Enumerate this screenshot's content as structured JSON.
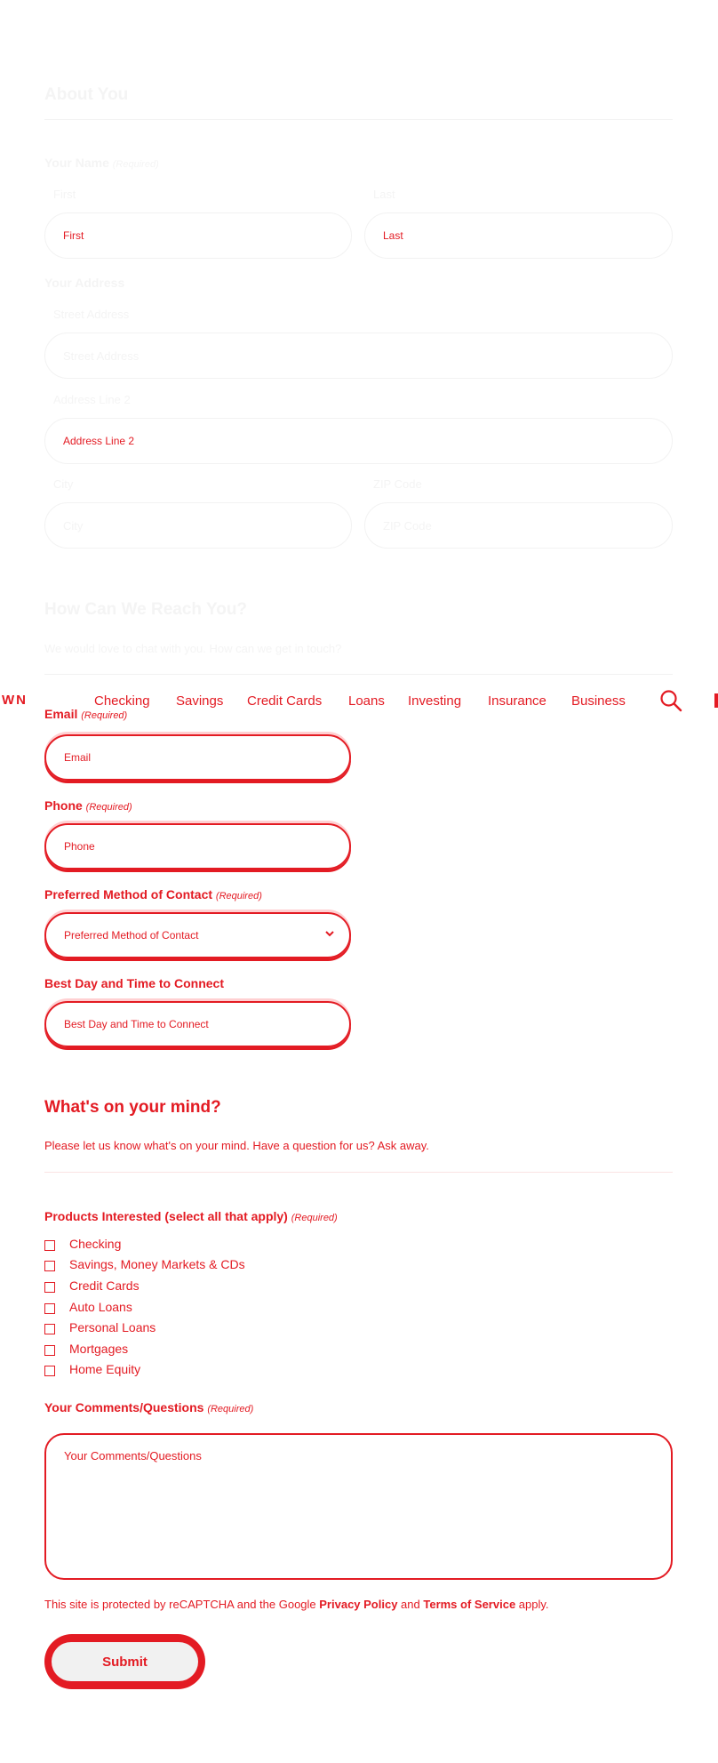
{
  "about": {
    "title": "About You",
    "name_label": "Your Name",
    "required": "(Required)",
    "first_label": "First",
    "last_label": "Last",
    "first_placeholder": "First",
    "last_placeholder": "Last",
    "address_label": "Your Address",
    "street_label": "Street Address",
    "street_placeholder": "Street Address",
    "line2_label": "Address Line 2",
    "line2_placeholder": "Address Line 2",
    "city_label": "City",
    "city_placeholder": "City",
    "zip_label": "ZIP Code",
    "zip_placeholder": "ZIP Code"
  },
  "reach": {
    "title": "How Can We Reach You?",
    "subtitle": "We would love to chat with you. How can we get in touch?"
  },
  "nav": {
    "brand": "WN",
    "items": [
      "Checking",
      "Savings",
      "Credit Cards",
      "Loans",
      "Investing",
      "Insurance",
      "Business"
    ]
  },
  "contact": {
    "email_label": "Email",
    "email_placeholder": "Email",
    "phone_label": "Phone",
    "phone_placeholder": "Phone",
    "method_label": "Preferred Method of Contact",
    "method_value": "Preferred Method of Contact",
    "besttime_label": "Best Day and Time to Connect",
    "besttime_placeholder": "Best Day and Time to Connect",
    "required": "(Required)"
  },
  "mind": {
    "title": "What's on your mind?",
    "subtitle": "Please let us know what's on your mind. Have a question for us? Ask away.",
    "products_label": "Products Interested (select all that apply)",
    "required": "(Required)",
    "products": [
      "Checking",
      "Savings, Money Markets & CDs",
      "Credit Cards",
      "Auto Loans",
      "Personal Loans",
      "Mortgages",
      "Home Equity"
    ],
    "comments_label": "Your Comments/Questions",
    "comments_placeholder": "Your Comments/Questions"
  },
  "recaptcha": {
    "prefix": "This site is protected by reCAPTCHA and the Google ",
    "privacy": "Privacy Policy",
    "and": " and ",
    "terms": "Terms of Service",
    "suffix": " apply."
  },
  "submit_label": "Submit",
  "colors": {
    "accent": "#e31b23",
    "faint": "#f4f4f4"
  }
}
